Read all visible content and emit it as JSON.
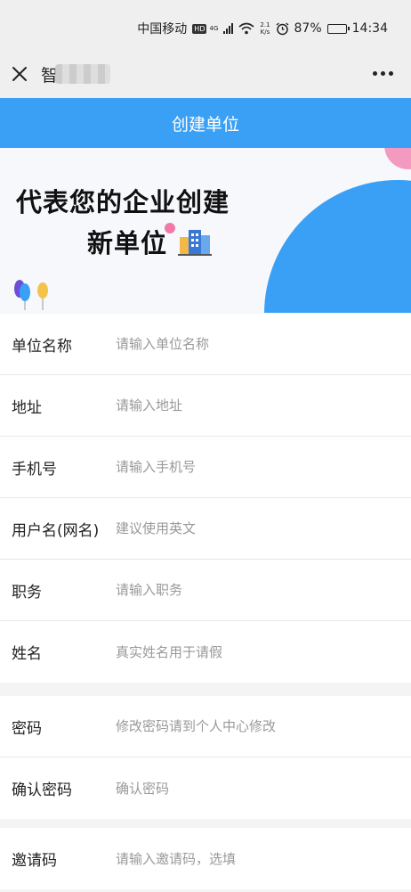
{
  "status_bar": {
    "carrier": "中国移动",
    "hd": "HD",
    "network": "4G",
    "speed_value": "2.1",
    "speed_unit": "K/s",
    "alarm_icon": "alarm-icon",
    "battery": "87%",
    "battery_level": 0.87,
    "time": "14:34"
  },
  "nav": {
    "title": "智"
  },
  "header": {
    "title": "创建单位"
  },
  "banner": {
    "line1": "代表您的企业创建",
    "line2": "新单位"
  },
  "form": {
    "group1": [
      {
        "label": "单位名称",
        "placeholder": "请输入单位名称"
      },
      {
        "label": "地址",
        "placeholder": "请输入地址"
      },
      {
        "label": "手机号",
        "placeholder": "请输入手机号"
      },
      {
        "label": "用户名(网名)",
        "placeholder": "建议使用英文"
      },
      {
        "label": "职务",
        "placeholder": "请输入职务"
      },
      {
        "label": "姓名",
        "placeholder": "真实姓名用于请假"
      }
    ],
    "group2": [
      {
        "label": "密码",
        "placeholder": "修改密码请到个人中心修改"
      },
      {
        "label": "确认密码",
        "placeholder": "确认密码"
      }
    ],
    "group3": [
      {
        "label": "邀请码",
        "placeholder": "请输入邀请码，选填"
      }
    ]
  },
  "colors": {
    "accent": "#3aa0f5",
    "pink": "#f39ac0"
  }
}
